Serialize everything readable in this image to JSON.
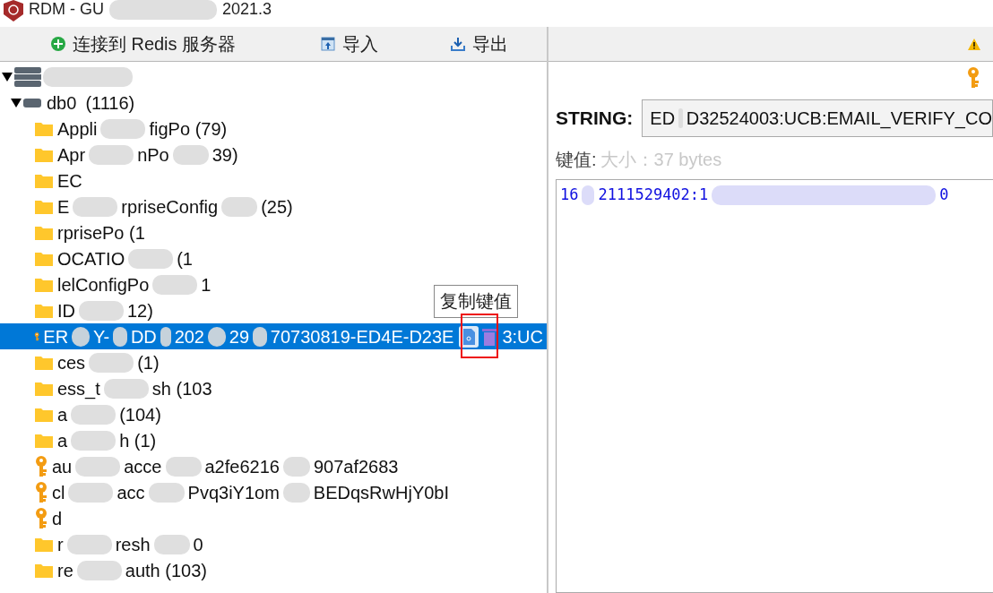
{
  "window": {
    "title_parts": [
      "RDM - GU",
      "2021.3"
    ]
  },
  "toolbar": {
    "buttons": [
      {
        "kind": "connect",
        "label": "连接到 Redis 服务器"
      },
      {
        "kind": "import",
        "label": "导入"
      },
      {
        "kind": "export",
        "label": "导出"
      }
    ]
  },
  "tree": {
    "server": {
      "expanded": true
    },
    "database": {
      "expanded": true,
      "name": "db0",
      "count": "(1116)"
    },
    "rows": [
      {
        "kind": "folder",
        "selected": false,
        "parts": [
          "Appli",
          "figPo (79)"
        ]
      },
      {
        "kind": "folder",
        "selected": false,
        "parts": [
          "Apr",
          "nPo",
          "39)"
        ]
      },
      {
        "kind": "folder",
        "selected": false,
        "parts": [
          "EC"
        ]
      },
      {
        "kind": "folder",
        "selected": false,
        "parts": [
          "E",
          "rpriseConfig",
          "(25)"
        ]
      },
      {
        "kind": "folder",
        "selected": false,
        "parts": [
          "rprisePo (1"
        ]
      },
      {
        "kind": "folder",
        "selected": false,
        "parts": [
          "OCATIO",
          "(1"
        ]
      },
      {
        "kind": "folder",
        "selected": false,
        "parts": [
          "lelConfigPo",
          "1"
        ]
      },
      {
        "kind": "folder",
        "selected": false,
        "parts": [
          "ID",
          "12)"
        ]
      },
      {
        "kind": "key",
        "selected": true,
        "parts": [
          "ER",
          "Y-",
          "DD",
          "202",
          "29",
          "70730819-ED4E-D23E"
        ],
        "tail": "3:UC",
        "tooltip": "复制键值"
      },
      {
        "kind": "folder",
        "selected": false,
        "parts": [
          "ces",
          "(1)"
        ]
      },
      {
        "kind": "folder",
        "selected": false,
        "parts": [
          "ess_t",
          "sh (103"
        ]
      },
      {
        "kind": "folder",
        "selected": false,
        "parts": [
          "a",
          "(104)"
        ]
      },
      {
        "kind": "folder",
        "selected": false,
        "parts": [
          "a",
          "h (1)"
        ]
      },
      {
        "kind": "key",
        "selected": false,
        "parts": [
          "au",
          "acce",
          "a2fe6216",
          "907af2683"
        ]
      },
      {
        "kind": "key",
        "selected": false,
        "parts": [
          "cl",
          "acc",
          "Pvq3iY1om",
          "BEDqsRwHjY0bI"
        ]
      },
      {
        "kind": "key",
        "selected": false,
        "parts": [
          "d"
        ]
      },
      {
        "kind": "folder",
        "selected": false,
        "parts": [
          "r",
          "resh",
          "0"
        ]
      },
      {
        "kind": "folder",
        "selected": false,
        "parts": [
          "re",
          "auth (103)"
        ]
      }
    ]
  },
  "value_panel": {
    "type_label": "STRING:",
    "key_parts": [
      "ED",
      "D32524003:UCB:EMAIL_VERIFY_CO"
    ],
    "value_label": "键值:",
    "size": "大小：37 bytes",
    "value_parts": [
      "16",
      "2111529402:1",
      "0"
    ]
  }
}
